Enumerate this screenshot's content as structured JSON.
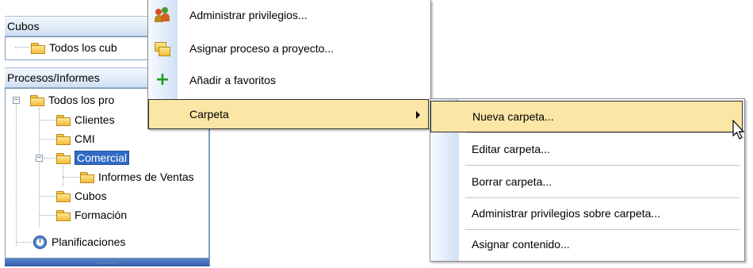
{
  "tree_panel": {
    "cubes_header": "Cubos",
    "cubes_items": [
      {
        "label": "Todos los cub"
      }
    ],
    "processes_header": "Procesos/Informes",
    "process_items": [
      {
        "label": "Todos los pro",
        "expander": "−"
      },
      {
        "label": "Clientes"
      },
      {
        "label": "CMI"
      },
      {
        "label": "Comercial",
        "expander": "−",
        "selected": true
      },
      {
        "label": "Informes de Ventas"
      },
      {
        "label": "Cubos"
      },
      {
        "label": "Formación"
      },
      {
        "label": "Planificaciones",
        "icon": "clock-icon"
      }
    ],
    "grip": "........."
  },
  "context_menu": {
    "items": [
      {
        "label": "Administrar privilegios...",
        "icon": "users-icon"
      },
      {
        "label": "Asignar proceso a proyecto...",
        "icon": "folders-icon"
      },
      {
        "label": "Añadir a favoritos",
        "icon": "plus-icon"
      },
      {
        "label": "Carpeta",
        "icon": "chevron-right-icon",
        "highlighted": true
      }
    ]
  },
  "submenu": {
    "items": [
      {
        "label": "Nueva carpeta...",
        "highlighted": true
      },
      {
        "label": "Editar carpeta..."
      },
      {
        "label": "Borrar carpeta..."
      },
      {
        "label": "Administrar privilegios sobre carpeta..."
      },
      {
        "label": "Asignar contenido..."
      }
    ]
  },
  "colors": {
    "highlight": "#fbe6a6",
    "selection": "#316ac5",
    "header_gradient_end": "#cfdff2"
  }
}
